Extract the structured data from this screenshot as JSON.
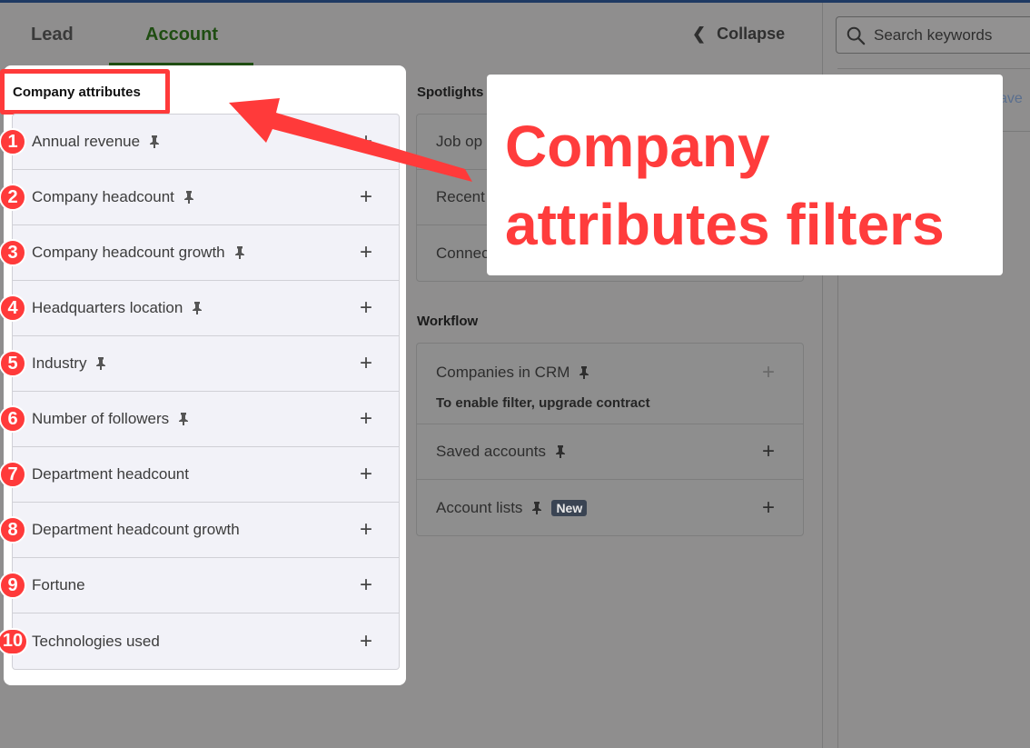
{
  "tabs": [
    {
      "label": "Lead",
      "active": false
    },
    {
      "label": "Account",
      "active": true
    }
  ],
  "collapse_label": "Collapse",
  "search": {
    "placeholder": "Search keywords"
  },
  "save_peek": "ave",
  "company_attributes": {
    "title": "Company attributes",
    "items": [
      {
        "num": "1",
        "label": "Annual revenue",
        "pinned": true
      },
      {
        "num": "2",
        "label": "Company headcount",
        "pinned": true
      },
      {
        "num": "3",
        "label": "Company headcount growth",
        "pinned": true
      },
      {
        "num": "4",
        "label": "Headquarters location",
        "pinned": true
      },
      {
        "num": "5",
        "label": "Industry",
        "pinned": true
      },
      {
        "num": "6",
        "label": "Number of followers",
        "pinned": true
      },
      {
        "num": "7",
        "label": "Department headcount",
        "pinned": false
      },
      {
        "num": "8",
        "label": "Department headcount growth",
        "pinned": false
      },
      {
        "num": "9",
        "label": "Fortune",
        "pinned": false
      },
      {
        "num": "10",
        "label": "Technologies used",
        "pinned": false
      }
    ]
  },
  "spotlights": {
    "title": "Spotlights",
    "items": [
      {
        "label": "Job op"
      },
      {
        "label": "Recent"
      },
      {
        "label": "Connec"
      }
    ]
  },
  "workflow": {
    "title": "Workflow",
    "items": [
      {
        "label": "Companies in CRM",
        "sub": "To enable filter, upgrade contract",
        "disabled": true
      },
      {
        "label": "Saved accounts"
      },
      {
        "label": "Account lists",
        "badge": "New"
      }
    ]
  },
  "callout": {
    "text": "Company attributes filters"
  },
  "colors": {
    "annotation_red": "#ff3a3a",
    "active_tab": "#1f4d12",
    "badge_bg": "#3a4453"
  }
}
